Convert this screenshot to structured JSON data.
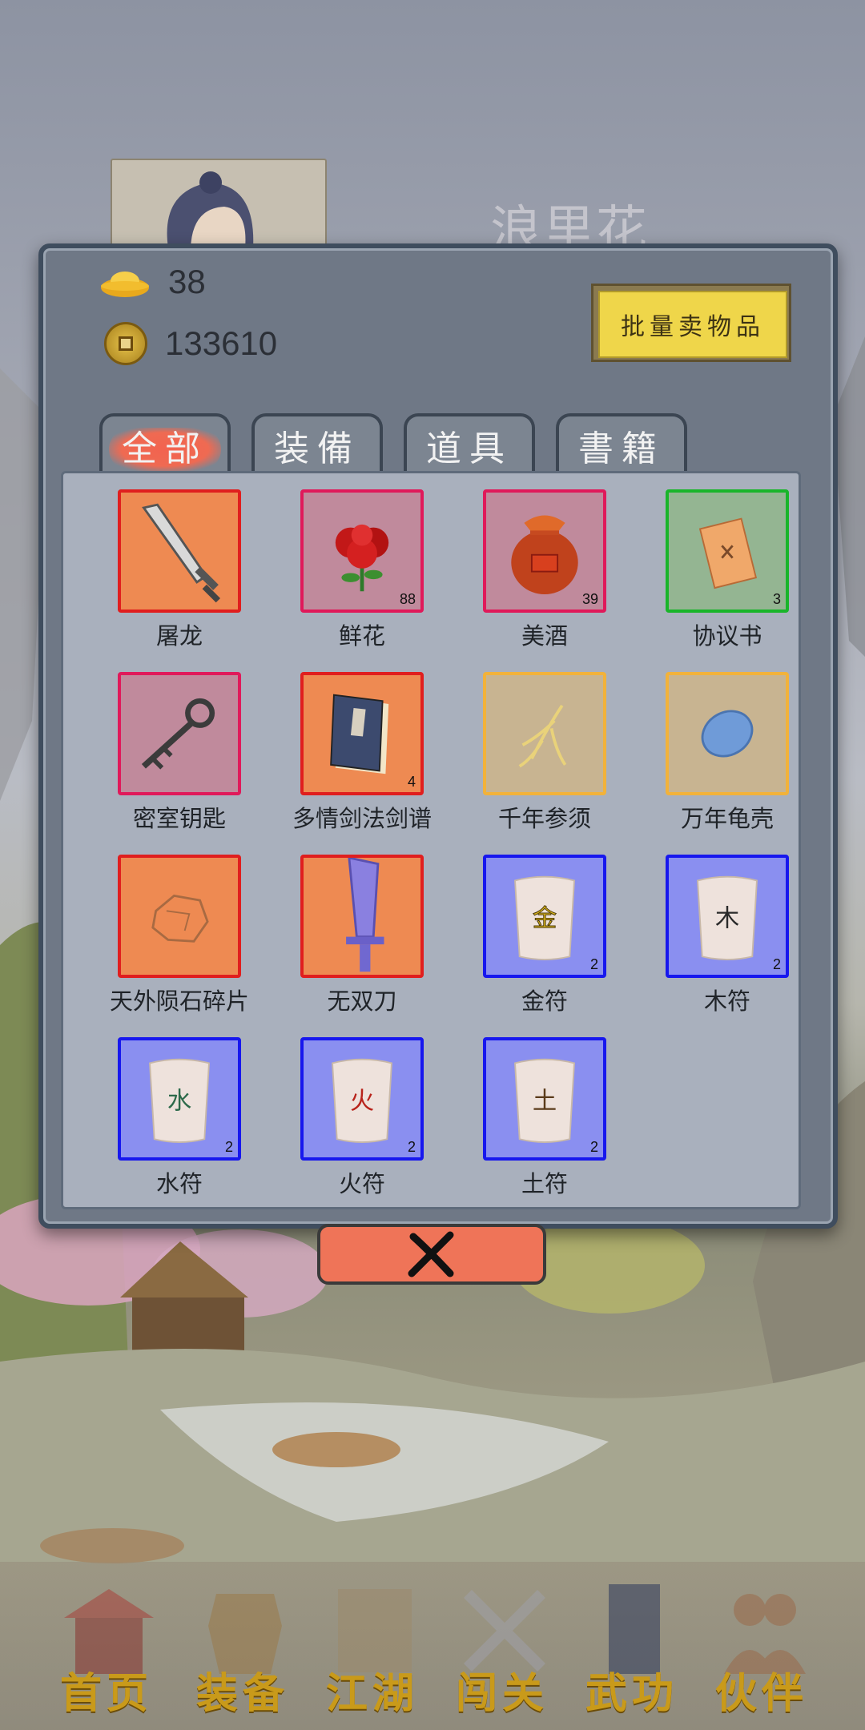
{
  "character": {
    "name": "浪里花"
  },
  "currency": {
    "gold_ingots": "38",
    "coins": "133610"
  },
  "sell_button": {
    "label": "批量卖物品"
  },
  "tabs": [
    {
      "label": "全部",
      "active": true
    },
    {
      "label": "装備",
      "active": false
    },
    {
      "label": "道具",
      "active": false
    },
    {
      "label": "書籍",
      "active": false
    }
  ],
  "items": [
    {
      "name": "屠龙",
      "count": "",
      "rarity": "red",
      "icon": "saber-icon"
    },
    {
      "name": "鲜花",
      "count": "88",
      "rarity": "pink",
      "icon": "rose-icon"
    },
    {
      "name": "美酒",
      "count": "39",
      "rarity": "pink",
      "icon": "wine-jar-icon"
    },
    {
      "name": "协议书",
      "count": "3",
      "rarity": "green",
      "icon": "contract-scroll-icon"
    },
    {
      "name": "密室钥匙",
      "count": "",
      "rarity": "pink",
      "icon": "key-icon"
    },
    {
      "name": "多情剑法剑谱",
      "count": "4",
      "rarity": "red",
      "icon": "manual-book-icon"
    },
    {
      "name": "千年参须",
      "count": "",
      "rarity": "gold",
      "icon": "ginseng-icon"
    },
    {
      "name": "万年龟壳",
      "count": "",
      "rarity": "gold",
      "icon": "turtle-shell-icon"
    },
    {
      "name": "天外陨石碎片",
      "count": "",
      "rarity": "red",
      "icon": "meteorite-icon"
    },
    {
      "name": "无双刀",
      "count": "",
      "rarity": "red",
      "icon": "blade-icon"
    },
    {
      "name": "金符",
      "count": "2",
      "rarity": "blue",
      "icon": "talisman-icon",
      "glyph": "金",
      "glyph_color": "#d8b21a"
    },
    {
      "name": "木符",
      "count": "2",
      "rarity": "blue",
      "icon": "talisman-icon",
      "glyph": "木",
      "glyph_color": "#2a2a2a"
    },
    {
      "name": "水符",
      "count": "2",
      "rarity": "blue",
      "icon": "talisman-icon",
      "glyph": "水",
      "glyph_color": "#2c6a4a"
    },
    {
      "name": "火符",
      "count": "2",
      "rarity": "blue",
      "icon": "talisman-icon",
      "glyph": "火",
      "glyph_color": "#b8231b"
    },
    {
      "name": "土符",
      "count": "2",
      "rarity": "blue",
      "icon": "talisman-icon",
      "glyph": "土",
      "glyph_color": "#5a3a1a"
    }
  ],
  "rarity_colors": {
    "red": {
      "border": "#e01e1e",
      "fill": "#ee8a52"
    },
    "pink": {
      "border": "#e0195a",
      "fill": "#c08a9c"
    },
    "green": {
      "border": "#19b52a",
      "fill": "#94b592"
    },
    "gold": {
      "border": "#f2b23a",
      "fill": "#c8b491"
    },
    "blue": {
      "border": "#1717ee",
      "fill": "#8a8ff0"
    }
  },
  "bottom_nav": [
    {
      "label": "首页",
      "icon": "home-pavilion-icon",
      "active": true
    },
    {
      "label": "装备",
      "icon": "armor-icon",
      "active": false
    },
    {
      "label": "江湖",
      "icon": "scroll-map-icon",
      "active": false
    },
    {
      "label": "闯关",
      "icon": "crossed-swords-icon",
      "active": false
    },
    {
      "label": "武功",
      "icon": "martial-book-icon",
      "active": false
    },
    {
      "label": "伙伴",
      "icon": "partners-icon",
      "active": false
    }
  ]
}
